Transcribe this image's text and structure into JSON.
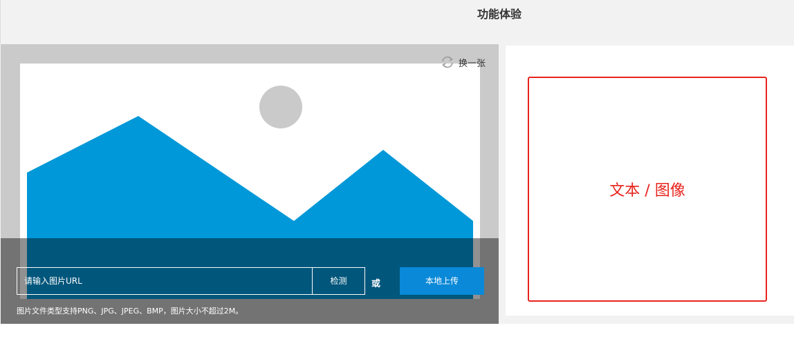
{
  "header": {
    "title": "功能体验"
  },
  "left_panel": {
    "switch": {
      "label": "换一张",
      "icon": "refresh-icon"
    },
    "placeholder_image": {
      "icon": "image-placeholder-icon",
      "sun_color": "#cacaca",
      "mountain_color": "#0098d8"
    },
    "url_input": {
      "placeholder": "请输入图片URL",
      "value": ""
    },
    "detect_button": {
      "label": "检测"
    },
    "or_text": "或",
    "upload_button": {
      "label": "本地上传",
      "color": "#0a89d8"
    },
    "hint": "图片文件类型支持PNG、JPG、JPEG、BMP，图片大小不超过2M。"
  },
  "right_panel": {
    "result_label": "文本 / 图像",
    "accent_color": "#e8231c"
  }
}
